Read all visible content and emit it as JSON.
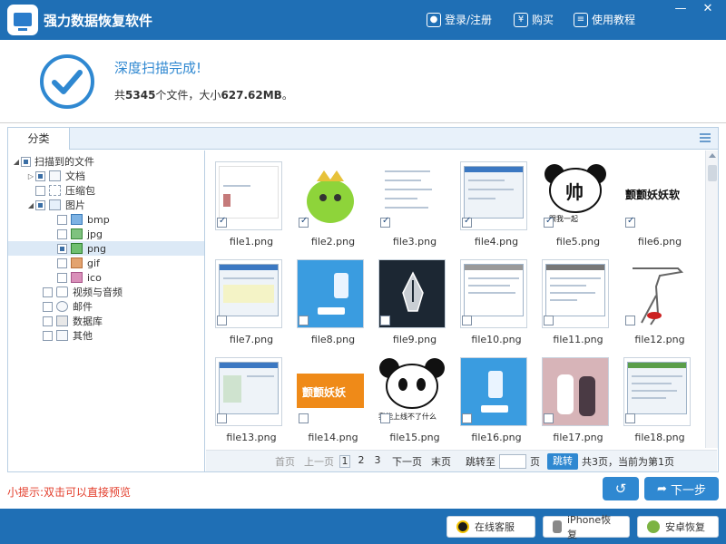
{
  "app": {
    "title": "强力数据恢复软件",
    "login_label": "登录/注册",
    "buy_label": "购买",
    "tutorial_label": "使用教程",
    "minimize": "—",
    "close": "✕"
  },
  "header": {
    "title": "深度扫描完成!",
    "summary_prefix": "共",
    "file_count": "5345",
    "summary_mid": "个文件，大小",
    "total_size": "627.62MB",
    "summary_suffix": "。"
  },
  "tab": {
    "label": "分类"
  },
  "tree": {
    "root": "扫描到的文件",
    "documents": "文档",
    "archives": "压缩包",
    "images": "图片",
    "bmp": "bmp",
    "jpg": "jpg",
    "png": "png",
    "gif": "gif",
    "ico": "ico",
    "video_audio": "视频与音频",
    "mail": "邮件",
    "database": "数据库",
    "other": "其他"
  },
  "files": [
    {
      "name": "file1.png",
      "checked": true
    },
    {
      "name": "file2.png",
      "checked": true
    },
    {
      "name": "file3.png",
      "checked": true
    },
    {
      "name": "file4.png",
      "checked": true
    },
    {
      "name": "file5.png",
      "checked": true
    },
    {
      "name": "file6.png",
      "checked": true
    },
    {
      "name": "file7.png",
      "checked": false
    },
    {
      "name": "file8.png",
      "checked": false
    },
    {
      "name": "file9.png",
      "checked": false
    },
    {
      "name": "file10.png",
      "checked": false
    },
    {
      "name": "file11.png",
      "checked": false
    },
    {
      "name": "file12.png",
      "checked": false
    },
    {
      "name": "file13.png",
      "checked": false
    },
    {
      "name": "file14.png",
      "checked": false
    },
    {
      "name": "file15.png",
      "checked": false
    },
    {
      "name": "file16.png",
      "checked": false
    },
    {
      "name": "file17.png",
      "checked": false
    },
    {
      "name": "file18.png",
      "checked": false
    }
  ],
  "thumb_text": {
    "file5": "帅",
    "file5_caption": "跟我一起",
    "file6": "颤颤妖妖软",
    "file14": "颤颤妖妖",
    "file15": "我能上线不了什么"
  },
  "pager": {
    "first": "首页",
    "prev": "上一页",
    "page1": "1",
    "page2": "2",
    "page3": "3",
    "next": "下一页",
    "last": "末页",
    "jump_label": "跳转至",
    "page_unit": "页",
    "jump_button": "跳转",
    "status": "共3页，当前为第1页"
  },
  "tip": "小提示:双击可以直接预览",
  "nav": {
    "back": "↺",
    "next_label": "下一步"
  },
  "footer": {
    "service": "在线客服",
    "iphone": "iPhone恢复",
    "android": "安卓恢复"
  },
  "colors": {
    "brand_blue": "#1f6fb5",
    "accent_blue": "#2f88d1",
    "tip_red": "#e33d2b"
  }
}
